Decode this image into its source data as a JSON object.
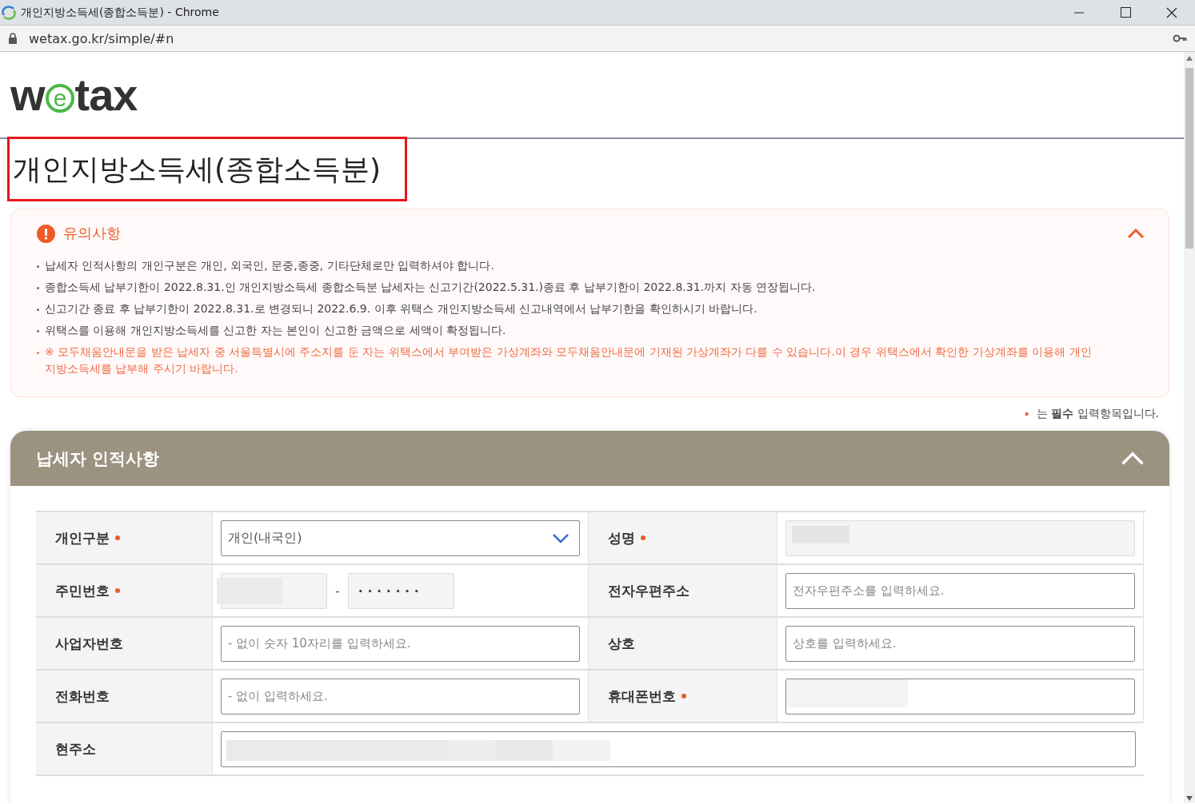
{
  "window": {
    "title": "개인지방소득세(종합소득분) - Chrome",
    "address": "wetax.go.kr/simple/#n"
  },
  "logo": [
    {
      "text": "w",
      "ringed": false
    },
    {
      "text": "e",
      "ringed": true
    },
    {
      "text": "tax",
      "ringed": false
    }
  ],
  "page_title": {
    "text": "개인지방소득세(종합소득분)",
    "highlighted": true
  },
  "notice": {
    "title": "유의사항",
    "expanded": true,
    "items": [
      {
        "kind": "normal",
        "text": "납세자 인적사항의 개인구분은 개인, 외국인, 문중,종중, 기타단체로만 입력하셔야 합니다."
      },
      {
        "kind": "normal",
        "text": "종합소득세 납부기한이 2022.8.31.인 개인지방소득세 종합소득분 납세자는 신고기간(2022.5.31.)종료 후 납부기한이 2022.8.31.까지 자동 연장됩니다."
      },
      {
        "kind": "normal",
        "text": "신고기간 종료 후 납부기한이 2022.8.31.로 변경되니 2022.6.9. 이후 위택스 개인지방소득세 신고내역에서 납부기한을 확인하시기 바랍니다."
      },
      {
        "kind": "normal",
        "text": "위택스를 이용해 개인지방소득세를 신고한 자는 본인이 신고한 금액으로 세액이 확정됩니다."
      },
      {
        "kind": "warning",
        "text": "※ 모두채움안내문을 받은 납세자 중 서울특별시에 주소지를 둔 자는 위택스에서 부여받은 가상계좌와 모두채움안내문에 기재된 가상계좌가 다를 수 있습니다.이 경우 위택스에서 확인한 가상계좌를 이용해 개인지방소득세를 납부해 주시기 바랍니다."
      }
    ]
  },
  "required_note": {
    "marker": "•",
    "text": "는 **필수** 입력항목입니다."
  },
  "section": {
    "title": "납세자 인적사항",
    "expanded": true,
    "rows": [
      [
        {
          "label": "개인구분",
          "required": true,
          "kind": "select",
          "value": "개인(내국인)"
        },
        {
          "label": "성명",
          "required": true,
          "kind": "masked"
        }
      ],
      [
        {
          "label": "주민번호",
          "required": true,
          "kind": "split",
          "separator": "-",
          "second_value": "· · · · · · ·"
        },
        {
          "label": "전자우편주소",
          "required": false,
          "kind": "input",
          "placeholder": "전자우편주소를 입력하세요."
        }
      ],
      [
        {
          "label": "사업자번호",
          "required": false,
          "kind": "input",
          "placeholder": "- 없이 숫자 10자리를 입력하세요."
        },
        {
          "label": "상호",
          "required": false,
          "kind": "input",
          "placeholder": "상호를 입력하세요."
        }
      ],
      [
        {
          "label": "전화번호",
          "required": false,
          "kind": "input",
          "placeholder": "- 없이 입력하세요."
        },
        {
          "label": "휴대폰번호",
          "required": true,
          "kind": "masked_input"
        }
      ],
      [
        {
          "label": "현주소",
          "required": false,
          "kind": "address"
        }
      ]
    ]
  }
}
